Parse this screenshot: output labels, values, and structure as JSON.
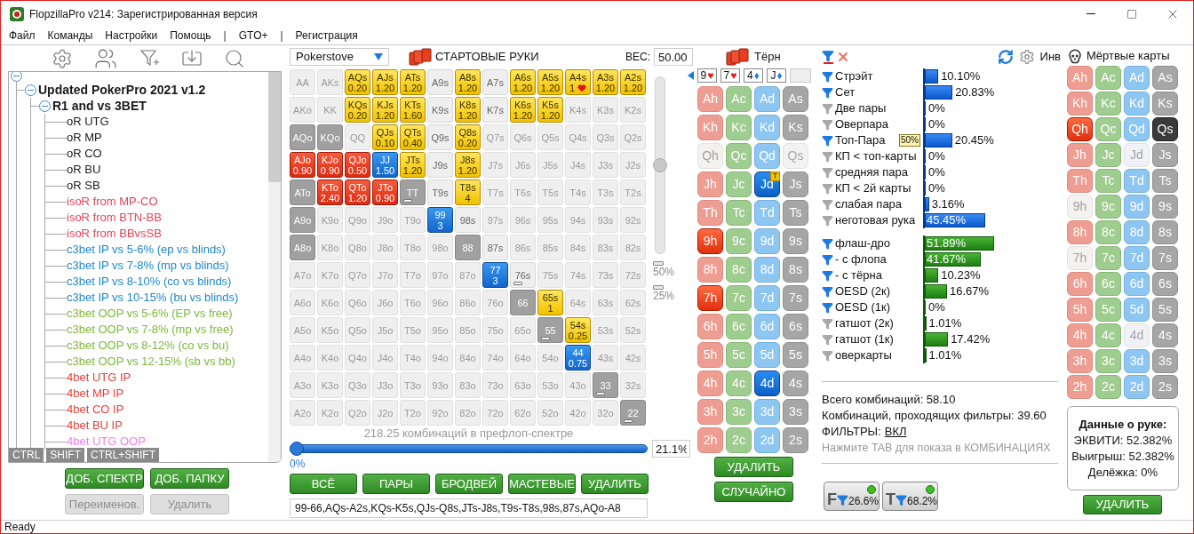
{
  "window": {
    "title": "FlopzillaPro v214: Зарегистрированная версия"
  },
  "menu": [
    {
      "label": "Файл",
      "kind": "item"
    },
    {
      "label": "Команды",
      "kind": "item"
    },
    {
      "label": "Настройки",
      "kind": "item"
    },
    {
      "label": "Помощь",
      "kind": "item"
    },
    {
      "label": "|",
      "kind": "separator"
    },
    {
      "label": "GTO+",
      "kind": "item"
    },
    {
      "label": "|",
      "kind": "separator"
    },
    {
      "label": "Регистрация",
      "kind": "item"
    }
  ],
  "tree": {
    "expanded": true,
    "children": [
      {
        "label": "Updated PokerPro 2021 v1.2",
        "expanded": true,
        "children": [
          {
            "label": "R1 and vs 3BET",
            "expanded": true,
            "children": [
              {
                "label": "oR UTG",
                "color": "#1a1a1a"
              },
              {
                "label": "oR MP",
                "color": "#1a1a1a"
              },
              {
                "label": "oR CO",
                "color": "#1a1a1a"
              },
              {
                "label": "oR BU",
                "color": "#1a1a1a"
              },
              {
                "label": "oR SB",
                "color": "#1a1a1a"
              },
              {
                "label": "isoR from MP-CO",
                "color": "#e2455a"
              },
              {
                "label": "isoR from BTN-BB",
                "color": "#e2455a"
              },
              {
                "label": "isoR from BBvsSB",
                "color": "#e2455a"
              },
              {
                "label": "c3bet IP vs 5-6% (ep vs blinds)",
                "color": "#1f86c9"
              },
              {
                "label": "c3bet IP vs 7-8% (mp vs blinds)",
                "color": "#1f86c9"
              },
              {
                "label": "c3bet IP vs 8-10% (co vs blinds)",
                "color": "#1f86c9"
              },
              {
                "label": "c3bet IP vs 10-15% (bu vs blinds)",
                "color": "#1f86c9"
              },
              {
                "label": "c3bet OOP vs 5-6% (EP vs free)",
                "color": "#7cb83a"
              },
              {
                "label": "c3bet OOP vs 7-8% (mp vs free)",
                "color": "#7cb83a"
              },
              {
                "label": "c3bet OOP vs 8-12% (co vs bu)",
                "color": "#7cb83a"
              },
              {
                "label": "c3bet OOP vs 12-15% (sb vs bb)",
                "color": "#7cb83a"
              },
              {
                "label": "4bet UTG IP",
                "color": "#e8403a"
              },
              {
                "label": "4bet MP IP",
                "color": "#e8403a"
              },
              {
                "label": "4bet CO IP",
                "color": "#e8403a"
              },
              {
                "label": "4bet BU IP",
                "color": "#e8403a"
              },
              {
                "label": "4bet UTG OOP",
                "color": "#f07ee8"
              }
            ]
          }
        ]
      }
    ]
  },
  "modifier_tags": [
    "CTRL",
    "SHIFT",
    "CTRL+SHIFT"
  ],
  "tree_buttons": [
    {
      "label": "ДОБ. СПЕКТР",
      "disabled": false
    },
    {
      "label": "ДОБ. ПАПКУ",
      "disabled": false
    },
    {
      "label": "Переименов.",
      "disabled": true
    },
    {
      "label": "Удалить",
      "disabled": true
    }
  ],
  "range": {
    "preset": "Pokerstove",
    "title": "СТАРТОВЫЕ РУКИ",
    "weight_label": "ВЕС:",
    "weight": "50.00",
    "weight_slider": {
      "level": 0.5
    },
    "markers": [
      "50%",
      "25%"
    ],
    "grid": [
      [
        {
          "label": "AA",
          "kind": "off"
        },
        {
          "label": "AKs",
          "kind": "off"
        },
        {
          "label": "AQs",
          "kind": "yellow",
          "value": "0.20"
        },
        {
          "label": "AJs",
          "kind": "yellow",
          "value": "1.20"
        },
        {
          "label": "ATs",
          "kind": "yellow",
          "value": "1.20"
        },
        {
          "label": "A9s",
          "kind": "dim"
        },
        {
          "label": "A8s",
          "kind": "yellow",
          "value": "1.20"
        },
        {
          "label": "A7s",
          "kind": "dim"
        },
        {
          "label": "A6s",
          "kind": "yellow",
          "value": "1.20"
        },
        {
          "label": "A5s",
          "kind": "yellow",
          "value": "1.20"
        },
        {
          "label": "A4s",
          "kind": "yellow",
          "value": "1",
          "heart": true
        },
        {
          "label": "A3s",
          "kind": "yellow",
          "value": "1.20"
        },
        {
          "label": "A2s",
          "kind": "yellow",
          "value": "1.20"
        }
      ],
      [
        {
          "label": "AKo",
          "kind": "off"
        },
        {
          "label": "KK",
          "kind": "off"
        },
        {
          "label": "KQs",
          "kind": "yellow",
          "value": "0.20"
        },
        {
          "label": "KJs",
          "kind": "yellow",
          "value": "1.20"
        },
        {
          "label": "KTs",
          "kind": "yellow",
          "value": "1.60"
        },
        {
          "label": "K9s",
          "kind": "dim"
        },
        {
          "label": "K8s",
          "kind": "yellow",
          "value": "1.20"
        },
        {
          "label": "K7s",
          "kind": "dim"
        },
        {
          "label": "K6s",
          "kind": "yellow",
          "value": "1.20"
        },
        {
          "label": "K5s",
          "kind": "yellow",
          "value": "1.20"
        },
        {
          "label": "K4s",
          "kind": "off"
        },
        {
          "label": "K3s",
          "kind": "off"
        },
        {
          "label": "K2s",
          "kind": "off"
        }
      ],
      [
        {
          "label": "AQo",
          "kind": "gray"
        },
        {
          "label": "KQo",
          "kind": "gray"
        },
        {
          "label": "QQ",
          "kind": "off"
        },
        {
          "label": "QJs",
          "kind": "yellow",
          "value": "0.10"
        },
        {
          "label": "QTs",
          "kind": "yellow",
          "value": "0.40"
        },
        {
          "label": "Q9s",
          "kind": "dim"
        },
        {
          "label": "Q8s",
          "kind": "yellow",
          "value": "0.20"
        },
        {
          "label": "Q7s",
          "kind": "off"
        },
        {
          "label": "Q6s",
          "kind": "off"
        },
        {
          "label": "Q5s",
          "kind": "off"
        },
        {
          "label": "Q4s",
          "kind": "off"
        },
        {
          "label": "Q3s",
          "kind": "off"
        },
        {
          "label": "Q2s",
          "kind": "off"
        }
      ],
      [
        {
          "label": "AJo",
          "kind": "red",
          "value": "0.90"
        },
        {
          "label": "KJo",
          "kind": "red",
          "value": "0.90"
        },
        {
          "label": "QJo",
          "kind": "red",
          "value": "0.50"
        },
        {
          "label": "JJ",
          "kind": "blue",
          "value": "1.50"
        },
        {
          "label": "JTs",
          "kind": "yellow",
          "value": "1.20"
        },
        {
          "label": "J9s",
          "kind": "dim"
        },
        {
          "label": "J8s",
          "kind": "yellow",
          "value": "1.20"
        },
        {
          "label": "J7s",
          "kind": "off"
        },
        {
          "label": "J6s",
          "kind": "off"
        },
        {
          "label": "J5s",
          "kind": "off"
        },
        {
          "label": "J4s",
          "kind": "off"
        },
        {
          "label": "J3s",
          "kind": "off"
        },
        {
          "label": "J2s",
          "kind": "off"
        }
      ],
      [
        {
          "label": "ATo",
          "kind": "gray"
        },
        {
          "label": "KTo",
          "kind": "red",
          "value": "2.40"
        },
        {
          "label": "QTo",
          "kind": "red",
          "value": "1.20"
        },
        {
          "label": "JTo",
          "kind": "red",
          "value": "0.90"
        },
        {
          "label": "TT",
          "kind": "gray",
          "bar": true
        },
        {
          "label": "T9s",
          "kind": "dim"
        },
        {
          "label": "T8s",
          "kind": "yellow",
          "value": "4"
        },
        {
          "label": "T7s",
          "kind": "off"
        },
        {
          "label": "T6s",
          "kind": "off"
        },
        {
          "label": "T5s",
          "kind": "off"
        },
        {
          "label": "T4s",
          "kind": "off"
        },
        {
          "label": "T3s",
          "kind": "off"
        },
        {
          "label": "T2s",
          "kind": "off"
        }
      ],
      [
        {
          "label": "A9o",
          "kind": "gray"
        },
        {
          "label": "K9o",
          "kind": "off"
        },
        {
          "label": "Q9o",
          "kind": "off"
        },
        {
          "label": "J9o",
          "kind": "off"
        },
        {
          "label": "T9o",
          "kind": "off"
        },
        {
          "label": "99",
          "kind": "blue",
          "value": "3"
        },
        {
          "label": "98s",
          "kind": "dim"
        },
        {
          "label": "97s",
          "kind": "off"
        },
        {
          "label": "96s",
          "kind": "off"
        },
        {
          "label": "95s",
          "kind": "off"
        },
        {
          "label": "94s",
          "kind": "off"
        },
        {
          "label": "93s",
          "kind": "off"
        },
        {
          "label": "92s",
          "kind": "off"
        }
      ],
      [
        {
          "label": "A8o",
          "kind": "gray"
        },
        {
          "label": "K8o",
          "kind": "off"
        },
        {
          "label": "Q8o",
          "kind": "off"
        },
        {
          "label": "J8o",
          "kind": "off"
        },
        {
          "label": "T8o",
          "kind": "off"
        },
        {
          "label": "98o",
          "kind": "off"
        },
        {
          "label": "88",
          "kind": "gray"
        },
        {
          "label": "87s",
          "kind": "dim"
        },
        {
          "label": "86s",
          "kind": "off"
        },
        {
          "label": "85s",
          "kind": "off"
        },
        {
          "label": "84s",
          "kind": "off"
        },
        {
          "label": "83s",
          "kind": "off"
        },
        {
          "label": "82s",
          "kind": "off"
        }
      ],
      [
        {
          "label": "A7o",
          "kind": "off"
        },
        {
          "label": "K7o",
          "kind": "off"
        },
        {
          "label": "Q7o",
          "kind": "off"
        },
        {
          "label": "J7o",
          "kind": "off"
        },
        {
          "label": "T7o",
          "kind": "off"
        },
        {
          "label": "97o",
          "kind": "off"
        },
        {
          "label": "87o",
          "kind": "off"
        },
        {
          "label": "77",
          "kind": "blue",
          "value": "3"
        },
        {
          "label": "76s",
          "kind": "dim",
          "bar": true
        },
        {
          "label": "75s",
          "kind": "off"
        },
        {
          "label": "74s",
          "kind": "off"
        },
        {
          "label": "73s",
          "kind": "off"
        },
        {
          "label": "72s",
          "kind": "off"
        }
      ],
      [
        {
          "label": "A6o",
          "kind": "off"
        },
        {
          "label": "K6o",
          "kind": "off"
        },
        {
          "label": "Q6o",
          "kind": "off"
        },
        {
          "label": "J6o",
          "kind": "off"
        },
        {
          "label": "T6o",
          "kind": "off"
        },
        {
          "label": "96o",
          "kind": "off"
        },
        {
          "label": "86o",
          "kind": "off"
        },
        {
          "label": "76o",
          "kind": "off"
        },
        {
          "label": "66",
          "kind": "gray"
        },
        {
          "label": "65s",
          "kind": "yellow",
          "value": "1"
        },
        {
          "label": "64s",
          "kind": "off"
        },
        {
          "label": "63s",
          "kind": "off"
        },
        {
          "label": "62s",
          "kind": "off"
        }
      ],
      [
        {
          "label": "A5o",
          "kind": "off"
        },
        {
          "label": "K5o",
          "kind": "off"
        },
        {
          "label": "Q5o",
          "kind": "off"
        },
        {
          "label": "J5o",
          "kind": "off"
        },
        {
          "label": "T5o",
          "kind": "off"
        },
        {
          "label": "95o",
          "kind": "off"
        },
        {
          "label": "85o",
          "kind": "off"
        },
        {
          "label": "75o",
          "kind": "off"
        },
        {
          "label": "65o",
          "kind": "off"
        },
        {
          "label": "55",
          "kind": "gray",
          "bar": true
        },
        {
          "label": "54s",
          "kind": "yellow",
          "value": "0.25"
        },
        {
          "label": "53s",
          "kind": "off"
        },
        {
          "label": "52s",
          "kind": "off"
        }
      ],
      [
        {
          "label": "A4o",
          "kind": "off"
        },
        {
          "label": "K4o",
          "kind": "off"
        },
        {
          "label": "Q4o",
          "kind": "off"
        },
        {
          "label": "J4o",
          "kind": "off"
        },
        {
          "label": "T4o",
          "kind": "off"
        },
        {
          "label": "94o",
          "kind": "off"
        },
        {
          "label": "84o",
          "kind": "off"
        },
        {
          "label": "74o",
          "kind": "off"
        },
        {
          "label": "64o",
          "kind": "off"
        },
        {
          "label": "54o",
          "kind": "off"
        },
        {
          "label": "44",
          "kind": "blue",
          "value": "0.75"
        },
        {
          "label": "43s",
          "kind": "off"
        },
        {
          "label": "42s",
          "kind": "off"
        }
      ],
      [
        {
          "label": "A3o",
          "kind": "off"
        },
        {
          "label": "K3o",
          "kind": "off"
        },
        {
          "label": "Q3o",
          "kind": "off"
        },
        {
          "label": "J3o",
          "kind": "off"
        },
        {
          "label": "T3o",
          "kind": "off"
        },
        {
          "label": "93o",
          "kind": "off"
        },
        {
          "label": "83o",
          "kind": "off"
        },
        {
          "label": "73o",
          "kind": "off"
        },
        {
          "label": "63o",
          "kind": "off"
        },
        {
          "label": "53o",
          "kind": "off"
        },
        {
          "label": "43o",
          "kind": "off"
        },
        {
          "label": "33",
          "kind": "gray",
          "bar": true
        },
        {
          "label": "32s",
          "kind": "off"
        }
      ],
      [
        {
          "label": "A2o",
          "kind": "off"
        },
        {
          "label": "K2o",
          "kind": "off"
        },
        {
          "label": "Q2o",
          "kind": "off"
        },
        {
          "label": "J2o",
          "kind": "off"
        },
        {
          "label": "T2o",
          "kind": "off"
        },
        {
          "label": "92o",
          "kind": "off"
        },
        {
          "label": "82o",
          "kind": "off"
        },
        {
          "label": "72o",
          "kind": "off"
        },
        {
          "label": "62o",
          "kind": "off"
        },
        {
          "label": "52o",
          "kind": "off"
        },
        {
          "label": "42o",
          "kind": "off"
        },
        {
          "label": "32o",
          "kind": "off"
        },
        {
          "label": "22",
          "kind": "gray",
          "bar": true
        }
      ]
    ],
    "combos": "218.25 комбинаций в префлоп-спектре",
    "percent_slider": {
      "level": 0
    },
    "percent_min": "0%",
    "percent": "21.1%",
    "buttons": [
      "ВСЁ",
      "ПАРЫ",
      "БРОДВЕЙ",
      "МАСТЕВЫЕ",
      "УДАЛИТЬ"
    ],
    "text": "99-66,AQs-A2s,KQs-K5s,QJs-Q8s,JTs-J8s,T9s-T8s,98s,87s,AQo-A8"
  },
  "turn": {
    "title": "Тёрн",
    "board": [
      {
        "kind": "hearts",
        "rank": "9",
        "symbol": "♥"
      },
      {
        "kind": "hearts",
        "rank": "7",
        "symbol": "♥"
      },
      {
        "kind": "diamonds",
        "rank": "4",
        "symbol": "♦"
      },
      {
        "kind": "diamonds",
        "rank": "J",
        "symbol": "♦"
      },
      {
        "kind": "empty"
      }
    ],
    "grid": [
      [
        {
          "label": "Ah",
          "kind": "hearts",
          "selected": false,
          "disabled": false
        },
        {
          "label": "Ac",
          "kind": "clubs",
          "selected": false,
          "disabled": false
        },
        {
          "label": "Ad",
          "kind": "diamonds",
          "selected": false,
          "disabled": false
        },
        {
          "label": "As",
          "kind": "spades",
          "selected": false,
          "disabled": false
        }
      ],
      [
        {
          "label": "Kh",
          "kind": "hearts",
          "selected": false,
          "disabled": false
        },
        {
          "label": "Kc",
          "kind": "clubs",
          "selected": false,
          "disabled": false
        },
        {
          "label": "Kd",
          "kind": "diamonds",
          "selected": false,
          "disabled": false
        },
        {
          "label": "Ks",
          "kind": "spades",
          "selected": false,
          "disabled": false
        }
      ],
      [
        {
          "label": "Qh",
          "kind": "hearts",
          "selected": false,
          "disabled": true
        },
        {
          "label": "Qc",
          "kind": "clubs",
          "selected": false,
          "disabled": false
        },
        {
          "label": "Qd",
          "kind": "diamonds",
          "selected": false,
          "disabled": false
        },
        {
          "label": "Qs",
          "kind": "spades",
          "selected": false,
          "disabled": true
        }
      ],
      [
        {
          "label": "Jh",
          "kind": "hearts",
          "selected": false,
          "disabled": false
        },
        {
          "label": "Jc",
          "kind": "clubs",
          "selected": false,
          "disabled": false
        },
        {
          "label": "Jd",
          "kind": "diamonds",
          "selected": true,
          "disabled": false,
          "badge": "T"
        },
        {
          "label": "Js",
          "kind": "spades",
          "selected": false,
          "disabled": false
        }
      ],
      [
        {
          "label": "Th",
          "kind": "hearts",
          "selected": false,
          "disabled": false
        },
        {
          "label": "Tc",
          "kind": "clubs",
          "selected": false,
          "disabled": false
        },
        {
          "label": "Td",
          "kind": "diamonds",
          "selected": false,
          "disabled": false
        },
        {
          "label": "Ts",
          "kind": "spades",
          "selected": false,
          "disabled": false
        }
      ],
      [
        {
          "label": "9h",
          "kind": "hearts",
          "selected": true,
          "disabled": false
        },
        {
          "label": "9c",
          "kind": "clubs",
          "selected": false,
          "disabled": false
        },
        {
          "label": "9d",
          "kind": "diamonds",
          "selected": false,
          "disabled": false
        },
        {
          "label": "9s",
          "kind": "spades",
          "selected": false,
          "disabled": false
        }
      ],
      [
        {
          "label": "8h",
          "kind": "hearts",
          "selected": false,
          "disabled": false
        },
        {
          "label": "8c",
          "kind": "clubs",
          "selected": false,
          "disabled": false
        },
        {
          "label": "8d",
          "kind": "diamonds",
          "selected": false,
          "disabled": false
        },
        {
          "label": "8s",
          "kind": "spades",
          "selected": false,
          "disabled": false
        }
      ],
      [
        {
          "label": "7h",
          "kind": "hearts",
          "selected": true,
          "disabled": false
        },
        {
          "label": "7c",
          "kind": "clubs",
          "selected": false,
          "disabled": false
        },
        {
          "label": "7d",
          "kind": "diamonds",
          "selected": false,
          "disabled": false
        },
        {
          "label": "7s",
          "kind": "spades",
          "selected": false,
          "disabled": false
        }
      ],
      [
        {
          "label": "6h",
          "kind": "hearts",
          "selected": false,
          "disabled": false
        },
        {
          "label": "6c",
          "kind": "clubs",
          "selected": false,
          "disabled": false
        },
        {
          "label": "6d",
          "kind": "diamonds",
          "selected": false,
          "disabled": false
        },
        {
          "label": "6s",
          "kind": "spades",
          "selected": false,
          "disabled": false
        }
      ],
      [
        {
          "label": "5h",
          "kind": "hearts",
          "selected": false,
          "disabled": false
        },
        {
          "label": "5c",
          "kind": "clubs",
          "selected": false,
          "disabled": false
        },
        {
          "label": "5d",
          "kind": "diamonds",
          "selected": false,
          "disabled": false
        },
        {
          "label": "5s",
          "kind": "spades",
          "selected": false,
          "disabled": false
        }
      ],
      [
        {
          "label": "4h",
          "kind": "hearts",
          "selected": false,
          "disabled": false
        },
        {
          "label": "4c",
          "kind": "clubs",
          "selected": false,
          "disabled": false
        },
        {
          "label": "4d",
          "kind": "diamonds",
          "selected": true,
          "disabled": false
        },
        {
          "label": "4s",
          "kind": "spades",
          "selected": false,
          "disabled": false
        }
      ],
      [
        {
          "label": "3h",
          "kind": "hearts",
          "selected": false,
          "disabled": false
        },
        {
          "label": "3c",
          "kind": "clubs",
          "selected": false,
          "disabled": false
        },
        {
          "label": "3d",
          "kind": "diamonds",
          "selected": false,
          "disabled": false
        },
        {
          "label": "3s",
          "kind": "spades",
          "selected": false,
          "disabled": false
        }
      ],
      [
        {
          "label": "2h",
          "kind": "hearts",
          "selected": false,
          "disabled": false
        },
        {
          "label": "2c",
          "kind": "clubs",
          "selected": false,
          "disabled": false
        },
        {
          "label": "2d",
          "kind": "diamonds",
          "selected": false,
          "disabled": false
        },
        {
          "label": "2s",
          "kind": "spades",
          "selected": false,
          "disabled": false
        }
      ]
    ],
    "buttons": [
      "УДАЛИТЬ",
      "СЛУЧАЙНО"
    ]
  },
  "filters": {
    "invert_label": "Инв",
    "groups": [
      {
        "kind": "made",
        "items": [
          {
            "label": "Стрэйт",
            "active": true,
            "level": 0.101,
            "reading": "10.10%"
          },
          {
            "label": "Сет",
            "active": true,
            "level": 0.2083,
            "reading": "20.83%"
          },
          {
            "label": "Две пары",
            "active": false,
            "level": 0,
            "reading": "0%"
          },
          {
            "label": "Оверпара",
            "active": false,
            "level": 0,
            "reading": "0%"
          },
          {
            "label": "Топ-Пара",
            "active": true,
            "level": 0.2045,
            "reading": "20.45%",
            "badge": "50%"
          },
          {
            "label": "КП < топ-карты",
            "active": false,
            "level": 0,
            "reading": "0%"
          },
          {
            "label": "средняя пара",
            "active": false,
            "level": 0,
            "reading": "0%"
          },
          {
            "label": "КП < 2й карты",
            "active": false,
            "level": 0,
            "reading": "0%"
          },
          {
            "label": "слабая пара",
            "active": false,
            "level": 0.0316,
            "reading": "3.16%"
          },
          {
            "label": "неготовая рука",
            "active": false,
            "level": 0.4545,
            "reading": "45.45%"
          }
        ]
      },
      {
        "kind": "draws",
        "items": [
          {
            "label": "флаш-дро",
            "active": true,
            "level": 0.5189,
            "reading": "51.89%"
          },
          {
            "label": "- с флопа",
            "active": true,
            "level": 0.4167,
            "reading": "41.67%"
          },
          {
            "label": "- с тёрна",
            "active": true,
            "level": 0.1023,
            "reading": "10.23%"
          },
          {
            "label": "OESD (2к)",
            "active": true,
            "level": 0.1667,
            "reading": "16.67%"
          },
          {
            "label": "OESD (1к)",
            "active": true,
            "level": 0,
            "reading": "0%"
          },
          {
            "label": "гатшот (2к)",
            "active": false,
            "level": 0.0101,
            "reading": "1.01%"
          },
          {
            "label": "гатшот (1к)",
            "active": false,
            "level": 0.1742,
            "reading": "17.42%"
          },
          {
            "label": "оверкарты",
            "active": false,
            "level": 0.0101,
            "reading": "1.01%"
          }
        ]
      }
    ],
    "total": "Всего комбинаций: 58.10",
    "passing": "Комбинаций, проходящих фильтры: 39.60",
    "filters_label": "ФИЛЬТРЫ:",
    "filters_link": "ВКЛ",
    "hint": "Нажмите TAB для показа в КОМБИНАЦИЯХ",
    "quick": [
      {
        "letter": "F",
        "reading": "26.6%",
        "on": true
      },
      {
        "letter": "T",
        "reading": "68.2%",
        "on": true
      }
    ]
  },
  "dead": {
    "title": "Мёртвые карты",
    "grid": [
      [
        {
          "label": "Ah",
          "kind": "hearts",
          "selected": false,
          "disabled": false
        },
        {
          "label": "Ac",
          "kind": "clubs",
          "selected": false,
          "disabled": false
        },
        {
          "label": "Ad",
          "kind": "diamonds",
          "selected": false,
          "disabled": false
        },
        {
          "label": "As",
          "kind": "spades",
          "selected": false,
          "disabled": false
        }
      ],
      [
        {
          "label": "Kh",
          "kind": "hearts",
          "selected": false,
          "disabled": false
        },
        {
          "label": "Kc",
          "kind": "clubs",
          "selected": false,
          "disabled": false
        },
        {
          "label": "Kd",
          "kind": "diamonds",
          "selected": false,
          "disabled": false
        },
        {
          "label": "Ks",
          "kind": "spades",
          "selected": false,
          "disabled": false
        }
      ],
      [
        {
          "label": "Qh",
          "kind": "hearts",
          "selected": true,
          "disabled": false
        },
        {
          "label": "Qc",
          "kind": "clubs",
          "selected": false,
          "disabled": false
        },
        {
          "label": "Qd",
          "kind": "diamonds",
          "selected": false,
          "disabled": false
        },
        {
          "label": "Qs",
          "kind": "spades",
          "selected": true,
          "disabled": false
        }
      ],
      [
        {
          "label": "Jh",
          "kind": "hearts",
          "selected": false,
          "disabled": false
        },
        {
          "label": "Jc",
          "kind": "clubs",
          "selected": false,
          "disabled": false
        },
        {
          "label": "Jd",
          "kind": "diamonds",
          "selected": false,
          "disabled": true
        },
        {
          "label": "Js",
          "kind": "spades",
          "selected": false,
          "disabled": false
        }
      ],
      [
        {
          "label": "Th",
          "kind": "hearts",
          "selected": false,
          "disabled": false
        },
        {
          "label": "Tc",
          "kind": "clubs",
          "selected": false,
          "disabled": false
        },
        {
          "label": "Td",
          "kind": "diamonds",
          "selected": false,
          "disabled": false
        },
        {
          "label": "Ts",
          "kind": "spades",
          "selected": false,
          "disabled": false
        }
      ],
      [
        {
          "label": "9h",
          "kind": "hearts",
          "selected": false,
          "disabled": true
        },
        {
          "label": "9c",
          "kind": "clubs",
          "selected": false,
          "disabled": false
        },
        {
          "label": "9d",
          "kind": "diamonds",
          "selected": false,
          "disabled": false
        },
        {
          "label": "9s",
          "kind": "spades",
          "selected": false,
          "disabled": false
        }
      ],
      [
        {
          "label": "8h",
          "kind": "hearts",
          "selected": false,
          "disabled": false
        },
        {
          "label": "8c",
          "kind": "clubs",
          "selected": false,
          "disabled": false
        },
        {
          "label": "8d",
          "kind": "diamonds",
          "selected": false,
          "disabled": false
        },
        {
          "label": "8s",
          "kind": "spades",
          "selected": false,
          "disabled": false
        }
      ],
      [
        {
          "label": "7h",
          "kind": "hearts",
          "selected": false,
          "disabled": true
        },
        {
          "label": "7c",
          "kind": "clubs",
          "selected": false,
          "disabled": false
        },
        {
          "label": "7d",
          "kind": "diamonds",
          "selected": false,
          "disabled": false
        },
        {
          "label": "7s",
          "kind": "spades",
          "selected": false,
          "disabled": false
        }
      ],
      [
        {
          "label": "6h",
          "kind": "hearts",
          "selected": false,
          "disabled": false
        },
        {
          "label": "6c",
          "kind": "clubs",
          "selected": false,
          "disabled": false
        },
        {
          "label": "6d",
          "kind": "diamonds",
          "selected": false,
          "disabled": false
        },
        {
          "label": "6s",
          "kind": "spades",
          "selected": false,
          "disabled": false
        }
      ],
      [
        {
          "label": "5h",
          "kind": "hearts",
          "selected": false,
          "disabled": false
        },
        {
          "label": "5c",
          "kind": "clubs",
          "selected": false,
          "disabled": false
        },
        {
          "label": "5d",
          "kind": "diamonds",
          "selected": false,
          "disabled": false
        },
        {
          "label": "5s",
          "kind": "spades",
          "selected": false,
          "disabled": false
        }
      ],
      [
        {
          "label": "4h",
          "kind": "hearts",
          "selected": false,
          "disabled": false
        },
        {
          "label": "4c",
          "kind": "clubs",
          "selected": false,
          "disabled": false
        },
        {
          "label": "4d",
          "kind": "diamonds",
          "selected": false,
          "disabled": true
        },
        {
          "label": "4s",
          "kind": "spades",
          "selected": false,
          "disabled": false
        }
      ],
      [
        {
          "label": "3h",
          "kind": "hearts",
          "selected": false,
          "disabled": false
        },
        {
          "label": "3c",
          "kind": "clubs",
          "selected": false,
          "disabled": false
        },
        {
          "label": "3d",
          "kind": "diamonds",
          "selected": false,
          "disabled": false
        },
        {
          "label": "3s",
          "kind": "spades",
          "selected": false,
          "disabled": false
        }
      ],
      [
        {
          "label": "2h",
          "kind": "hearts",
          "selected": false,
          "disabled": false
        },
        {
          "label": "2c",
          "kind": "clubs",
          "selected": false,
          "disabled": false
        },
        {
          "label": "2d",
          "kind": "diamonds",
          "selected": false,
          "disabled": false
        },
        {
          "label": "2s",
          "kind": "spades",
          "selected": false,
          "disabled": false
        }
      ]
    ],
    "hand_data": {
      "title": "Данные о руке:",
      "lines": [
        "ЭКВИТИ: 52.382%",
        "Выигрыш: 52.382%",
        "Делёжка: 0%"
      ]
    },
    "button": "УДАЛИТЬ"
  },
  "status_bar": "Ready"
}
